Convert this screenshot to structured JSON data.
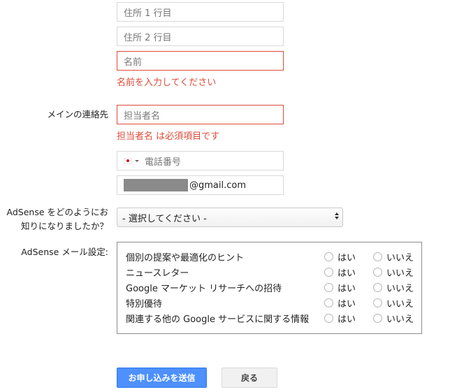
{
  "address": {
    "line1_placeholder": "住所 1 行目",
    "line2_placeholder": "住所 2 行目",
    "name_placeholder": "名前",
    "name_error": "名前を入力してください"
  },
  "main_contact": {
    "label": "メインの連絡先",
    "placeholder": "担当者名",
    "error": "担当者名 は必須項目です",
    "phone_country": "Japan",
    "phone_placeholder": "電話番号",
    "email_visible_suffix": "@gmail.com"
  },
  "how_heard": {
    "label_line1": "AdSense をどのようにお",
    "label_line2": "知りになりましたか？",
    "selected": "- 選択してください -"
  },
  "mail_settings": {
    "label": "AdSense メール設定:",
    "yes_label": "はい",
    "no_label": "いいえ",
    "rows": [
      "個別の提案や最適化のヒント",
      "ニュースレター",
      "Google マーケット リサーチへの招待",
      "特別優待",
      "関連する他の Google サービスに関する情報"
    ]
  },
  "buttons": {
    "submit": "お申し込みを送信",
    "back": "戻る"
  },
  "colors": {
    "error": "#dd4b39",
    "primary": "#4d90fe"
  }
}
